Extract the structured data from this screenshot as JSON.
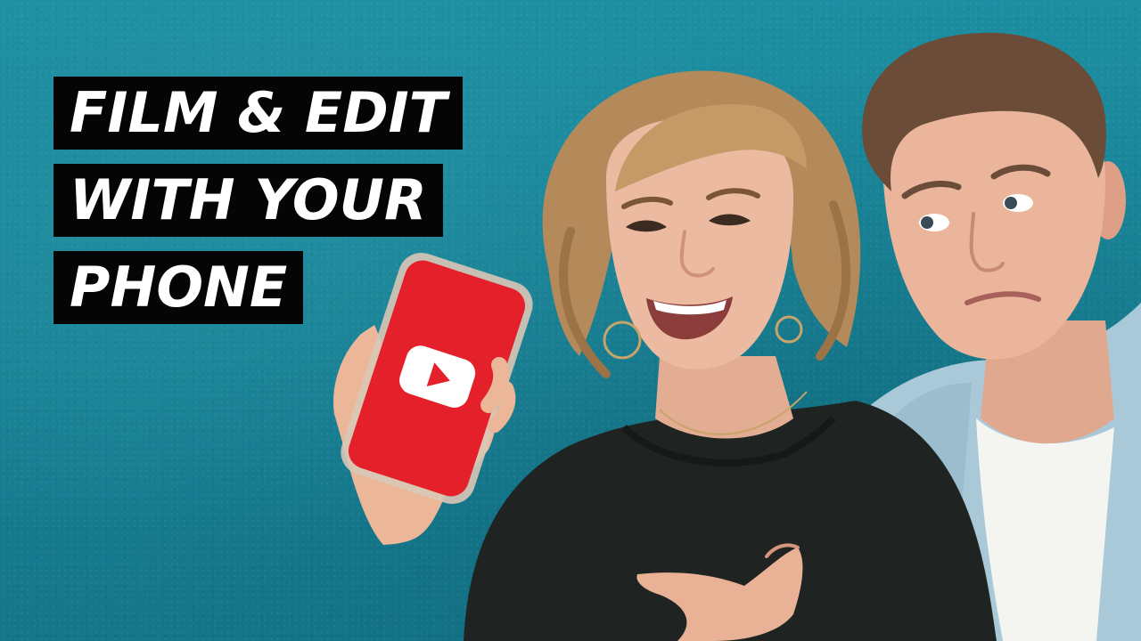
{
  "thumbnail": {
    "headline": [
      "FILM & EDIT",
      "WITH YOUR",
      "PHONE"
    ]
  },
  "phone_screen": {
    "app_icon": "youtube-play-icon"
  },
  "colors": {
    "background": "#1a8396",
    "headline_bg": "#050505",
    "headline_text": "#ffffff",
    "phone_screen": "#e4212a",
    "shirt": "#1f2422",
    "jacket": "#a9c9d8"
  }
}
